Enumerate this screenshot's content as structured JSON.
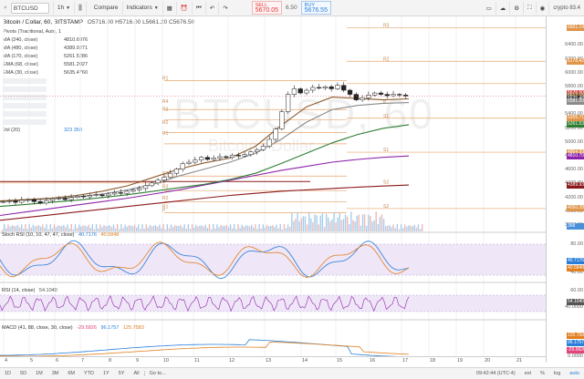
{
  "toolbar": {
    "symbol": "BTCUSD",
    "interval": "1h",
    "compare_label": "Compare",
    "indicators_label": "Indicators",
    "sell_label": "SELL",
    "sell_price": "5670.05",
    "spread": "6.50",
    "buy_label": "BUY",
    "buy_price": "5676.55",
    "account": "crypto 83.4"
  },
  "header": {
    "title": "Bitcoin / Dollar, 60, BITSTAMP",
    "ohlc": "O5716.00  H5716.00  L5661.20  C5676.50"
  },
  "legend": [
    {
      "name": "Pivots (Traditional, Auto, 15)",
      "value": ""
    },
    {
      "name": "MA (240, close)",
      "value": "4810.6976"
    },
    {
      "name": "MA (480, close)",
      "value": "4389.9271"
    },
    {
      "name": "MA (170, close)",
      "value": "5261.5286"
    },
    {
      "name": "EMA (68, close)",
      "value": "5581.2027"
    },
    {
      "name": "EMA (30, close)",
      "value": "5635.4760"
    },
    {
      "name": "",
      "value": ""
    },
    {
      "name": "",
      "value": ""
    },
    {
      "name": "",
      "value": ""
    },
    {
      "name": "",
      "value": ""
    },
    {
      "name": "",
      "value": ""
    },
    {
      "name": "",
      "value": ""
    },
    {
      "name": "Vol (20)",
      "value": "323   350"
    }
  ],
  "watermark": {
    "symbol": "BTCUSD, 60",
    "name": "Bitcoin / Dollar"
  },
  "pivot_labels": [
    "R3",
    "R2",
    "R1",
    "R4",
    "R3",
    "R2",
    "R1",
    "P",
    "S1",
    "S2",
    "S3",
    "R3",
    "R2",
    "R1",
    "P",
    "S1",
    "S2"
  ],
  "price_axis": {
    "ticks": [
      "6400.00",
      "6200.00",
      "6000.00",
      "5800.00",
      "5400.00",
      "5200.00",
      "5000.00",
      "4800.00",
      "4600.00",
      "4400.00",
      "4200.00",
      "4000.00",
      "3800.00"
    ],
    "tags": [
      {
        "text": "6661.14",
        "color": "#e0954a"
      },
      {
        "text": "6178.42",
        "color": "#e0954a"
      },
      {
        "text": "5676.50",
        "color": "#d64541"
      },
      {
        "text": "5617.15",
        "color": "#8c5a2b"
      },
      {
        "text": "5635.48",
        "color": "#333333"
      },
      {
        "text": "5581.20",
        "color": "#8a8a8a"
      },
      {
        "text": "5355.71",
        "color": "#e0954a"
      },
      {
        "text": "5261.53",
        "color": "#2e7d32"
      },
      {
        "text": "4864.99",
        "color": "#e0954a"
      },
      {
        "text": "4810.70",
        "color": "#8e24aa"
      },
      {
        "text": "4389.93",
        "color": "#8b1a1a"
      },
      {
        "text": "4050.28",
        "color": "#e0954a"
      },
      {
        "text": "368",
        "color": "#4a90d9"
      }
    ]
  },
  "stoch": {
    "label": "Stoch RSI (10, 10, 47, 47, close)",
    "v1": "40.7176",
    "v2": "40.5848",
    "ticks": [
      "80.00",
      "40.00"
    ],
    "tags": [
      "40.7176",
      "40.5848"
    ]
  },
  "rsi": {
    "label": "RSI (14, close)",
    "v1": "54.1040",
    "ticks": [
      "60.00",
      "40.0000"
    ],
    "tags": [
      "54.1040"
    ]
  },
  "macd": {
    "label": "MACD (41, 88, close, 30, close)",
    "v1": "-29.5826",
    "v2": "96.1757",
    "v3": "125.7583",
    "ticks": [
      "0.0000"
    ],
    "tags": [
      "125.7583",
      "96.1757",
      "-29.5826"
    ]
  },
  "time_axis": [
    "4",
    "5",
    "6",
    "7",
    "8",
    "9",
    "10",
    "11",
    "12",
    "13",
    "14",
    "15",
    "16",
    "17",
    "18",
    "19",
    "20",
    "21"
  ],
  "bottom": {
    "ranges": [
      "1D",
      "5D",
      "1M",
      "3M",
      "6M",
      "YTD",
      "1Y",
      "5Y",
      "All",
      "Go to..."
    ],
    "clock": "09:42:44 (UTC-4)",
    "ext": "ext",
    "pct": "%",
    "log": "log",
    "auto": "auto"
  },
  "chart_data": {
    "type": "candlestick",
    "series": [
      {
        "name": "price",
        "values": [
          4150,
          4160,
          4140,
          4170,
          4180,
          4150,
          4130,
          4165,
          4190,
          4200,
          4180,
          4210,
          4230,
          4220,
          4240,
          4250,
          4235,
          4260,
          4280,
          4270,
          4300,
          4320,
          4340,
          4380,
          4420,
          4460,
          4500,
          4560,
          4620,
          4700,
          4720,
          4750,
          4790,
          4760,
          4780,
          4800,
          4790,
          4820,
          4810,
          4830,
          4870,
          4900,
          4950,
          5050,
          5200,
          5450,
          5700,
          5780,
          5720,
          5760,
          5800,
          5790,
          5810,
          5780,
          5830,
          5760,
          5700,
          5620,
          5650,
          5690,
          5720,
          5700,
          5680,
          5700,
          5690,
          5676
        ]
      },
      {
        "name": "MA (240, close)",
        "values": [
          3950,
          4000,
          4050,
          4100,
          4150,
          4200,
          4260,
          4320,
          4390,
          4460,
          4530,
          4600,
          4660,
          4720,
          4760,
          4790,
          4810
        ]
      },
      {
        "name": "MA (480, close)",
        "values": [
          3880,
          3920,
          3960,
          4000,
          4040,
          4080,
          4120,
          4160,
          4200,
          4240,
          4270,
          4300,
          4320,
          4340,
          4360,
          4375,
          4390
        ]
      },
      {
        "name": "MA (170, close)",
        "values": [
          4080,
          4110,
          4140,
          4170,
          4210,
          4250,
          4300,
          4350,
          4400,
          4470,
          4560,
          4700,
          4850,
          5000,
          5120,
          5210,
          5261
        ]
      },
      {
        "name": "EMA (68, close)",
        "values": [
          4150,
          4170,
          4190,
          4220,
          4260,
          4320,
          4400,
          4520,
          4620,
          4720,
          4850,
          5050,
          5300,
          5480,
          5540,
          5570,
          5581
        ]
      },
      {
        "name": "EMA (30, close)",
        "values": [
          4160,
          4180,
          4200,
          4240,
          4300,
          4380,
          4500,
          4620,
          4710,
          4780,
          4950,
          5250,
          5520,
          5660,
          5640,
          5620,
          5635
        ]
      }
    ]
  }
}
